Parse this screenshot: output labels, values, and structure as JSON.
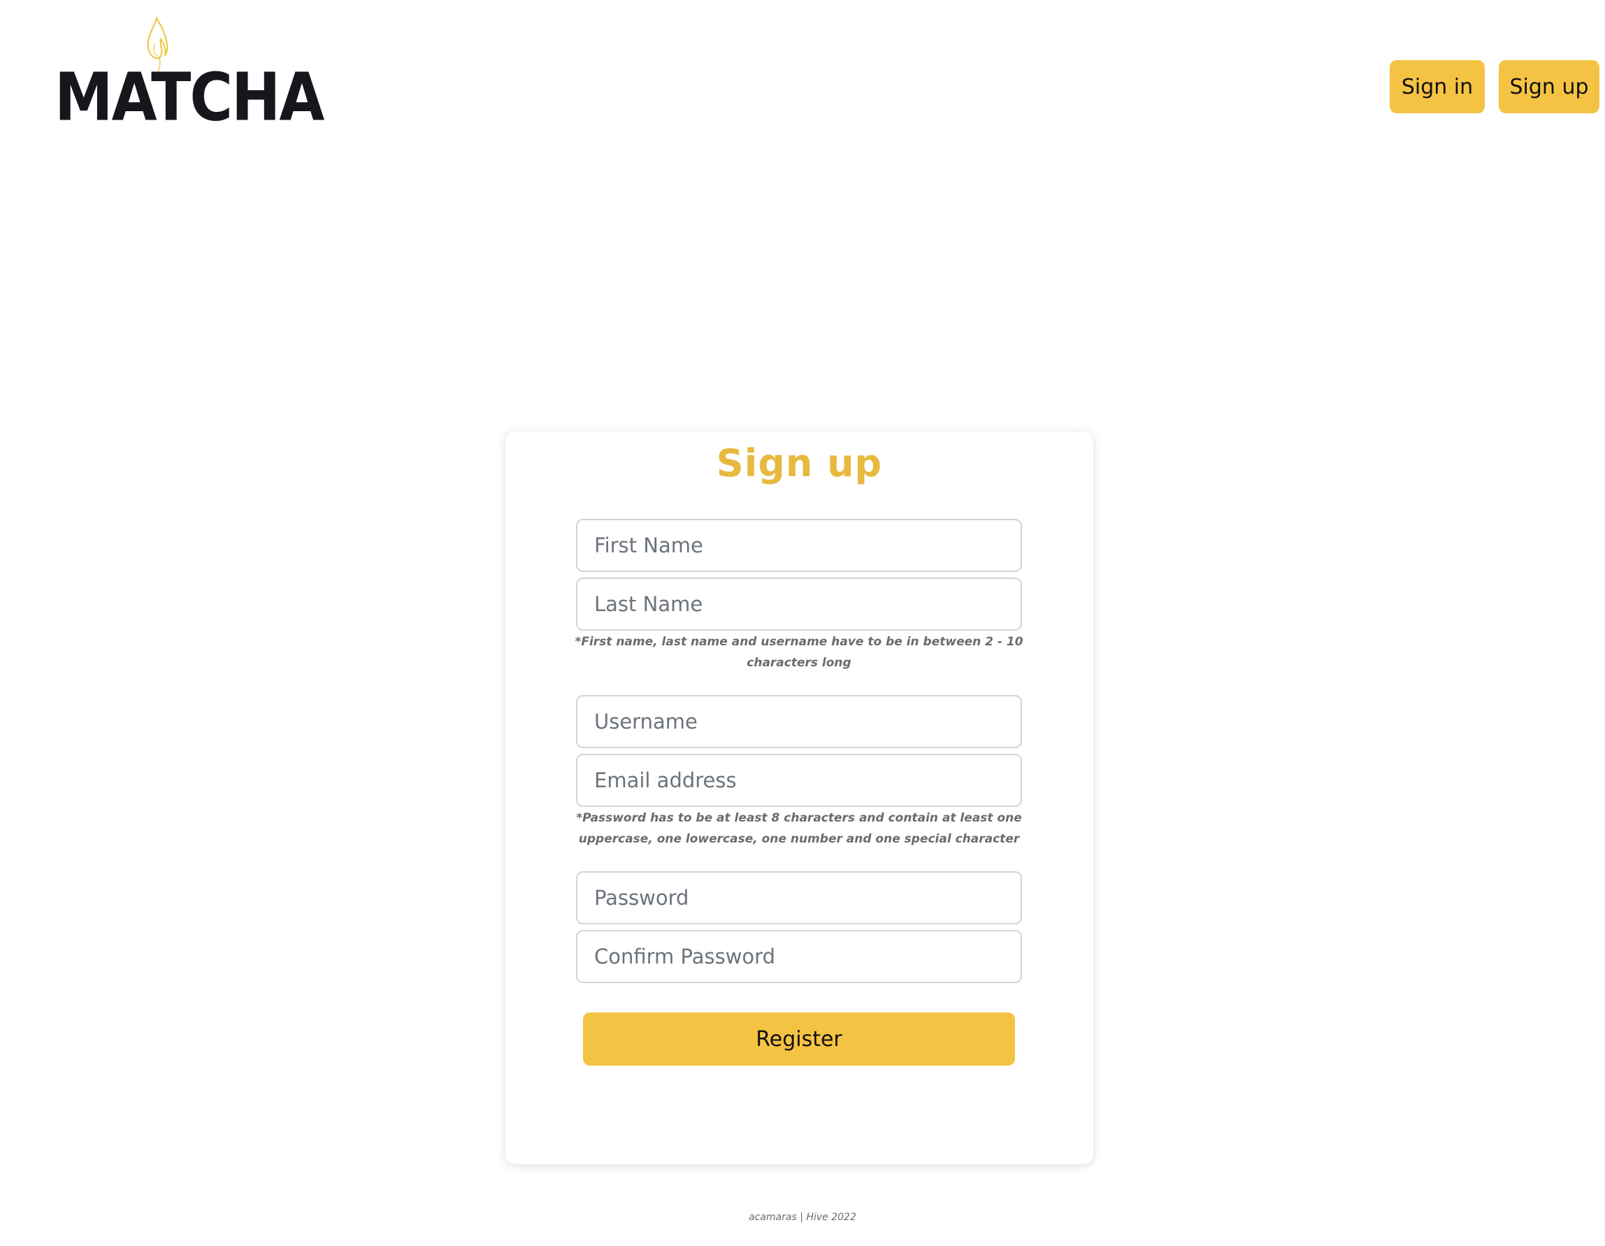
{
  "header": {
    "logo_text": "MATCHA",
    "signin_label": "Sign in",
    "signup_label": "Sign up"
  },
  "form": {
    "title": "Sign up",
    "first_name_placeholder": "First Name",
    "last_name_placeholder": "Last Name",
    "name_hint": "*First name, last name and username have to be in between 2 - 10 characters long",
    "username_placeholder": "Username",
    "email_placeholder": "Email address",
    "password_hint": "*Password has to be at least 8 characters and contain at least one uppercase, one lowercase, one number and one special character",
    "password_placeholder": "Password",
    "confirm_password_placeholder": "Confirm Password",
    "register_label": "Register"
  },
  "footer": {
    "text": "acamaras | Hive 2022"
  },
  "colors": {
    "accent": "#f5c344",
    "title": "#e8b93f",
    "text_dark": "#111111",
    "hint": "#6b6b6b"
  },
  "icons": {
    "logo_flame": "flame-icon"
  }
}
